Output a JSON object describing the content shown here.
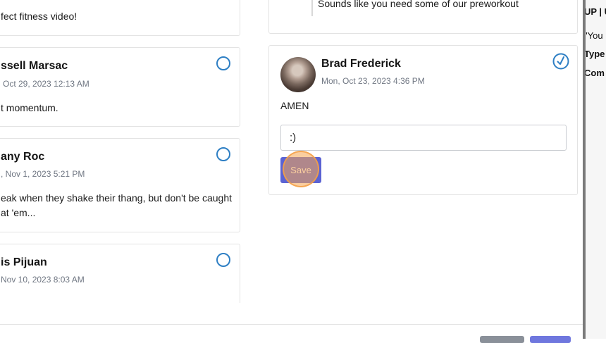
{
  "left_column": {
    "top_card": {
      "body": "fect fitness video!"
    },
    "comments": [
      {
        "name": "ssell Marsac",
        "date": "Oct 29, 2023 12:13 AM",
        "body": "t momentum."
      },
      {
        "name": "any Roc",
        "date": ", Nov 1, 2023 5:21 PM",
        "body_line1": "eak when they shake their thang, but don't be caught",
        "body_line2": "at 'em..."
      },
      {
        "name": "is Pijuan",
        "date": "Nov 10, 2023 8:03 AM"
      }
    ]
  },
  "right_column": {
    "top_card": {
      "reply": "Sounds like you need some of our preworkout"
    },
    "selected_comment": {
      "name": "Brad Frederick",
      "date": "Mon, Oct 23, 2023 4:36 PM",
      "body": "AMEN",
      "reply_value": ":)",
      "save_label": "Save"
    }
  },
  "side_panel": {
    "line1": "UP | U",
    "line2": "\"You",
    "line3": "Type",
    "line4": "Com"
  },
  "colors": {
    "accent": "#5b63d3",
    "radio": "#2e7fc4",
    "highlight": "#f5a650"
  }
}
